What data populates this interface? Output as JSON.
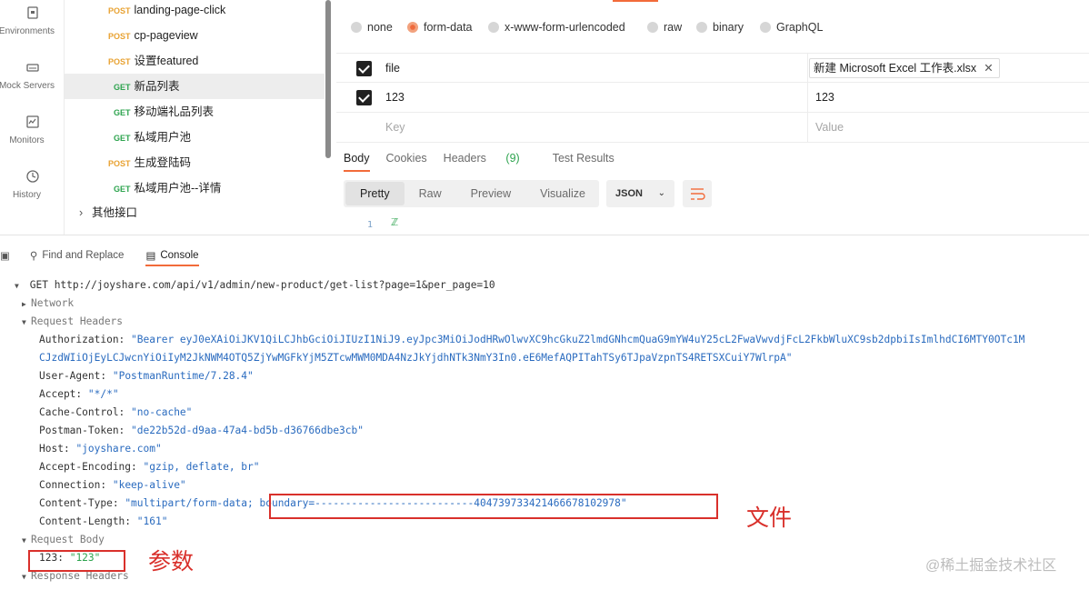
{
  "rail": {
    "items": [
      {
        "label": "Environments",
        "icon": "environments-icon"
      },
      {
        "label": "Mock Servers",
        "icon": "mock-servers-icon"
      },
      {
        "label": "Monitors",
        "icon": "monitors-icon"
      },
      {
        "label": "History",
        "icon": "history-icon"
      }
    ]
  },
  "tree": {
    "items": [
      {
        "method": "POST",
        "name": "landing-page-click"
      },
      {
        "method": "POST",
        "name": "cp-pageview"
      },
      {
        "method": "POST",
        "name": "设置featured"
      },
      {
        "method": "GET",
        "name": "新品列表"
      },
      {
        "method": "GET",
        "name": "移动端礼品列表"
      },
      {
        "method": "GET",
        "name": "私域用户池"
      },
      {
        "method": "POST",
        "name": "生成登陆码"
      },
      {
        "method": "GET",
        "name": "私域用户池--详情"
      }
    ],
    "folder": "其他接口"
  },
  "body_types": [
    "none",
    "form-data",
    "x-www-form-urlencoded",
    "raw",
    "binary",
    "GraphQL"
  ],
  "form_rows": [
    {
      "key": "file",
      "value": "新建 Microsoft Excel 工作表.xlsx"
    },
    {
      "key": "123",
      "value": "123"
    }
  ],
  "form_placeholder": {
    "key": "Key",
    "value": "Value"
  },
  "response": {
    "tabs": {
      "body": "Body",
      "cookies": "Cookies",
      "headers": "Headers",
      "headers_count": "(9)",
      "tests": "Test Results"
    },
    "views": [
      "Pretty",
      "Raw",
      "Preview",
      "Visualize"
    ],
    "format": "JSON",
    "line_number": "1"
  },
  "console": {
    "tabs": {
      "find": "Find and Replace",
      "console": "Console"
    },
    "request_line": "GET http://joyshare.com/api/v1/admin/new-product/get-list?page=1&per_page=10",
    "network": "Network",
    "request_headers_title": "Request Headers",
    "headers": [
      {
        "k": "Authorization:",
        "v": "\"Bearer eyJ0eXAiOiJKV1QiLCJhbGciOiJIUzI1NiJ9.eyJpc3MiOiJodHRwOlwvXC9hcGkuZ2lmdGNhcmQuaG9mYW4uY25cL2FwaVwvdjFcL2FkbWluXC9sb2dpbiIsImlhdCI6MTY0OTc1M"
      },
      {
        "k": "",
        "v": "CJzdWIiOjEyLCJwcnYiOiIyM2JkNWM4OTQ5ZjYwMGFkYjM5ZTcwMWM0MDA4NzJkYjdhNTk3NmY3In0.eE6MefAQPITahTSy6TJpaVzpnTS4RETSXCuiY7WlrpA\""
      },
      {
        "k": "User-Agent:",
        "v": "\"PostmanRuntime/7.28.4\""
      },
      {
        "k": "Accept:",
        "v": "\"*/*\""
      },
      {
        "k": "Cache-Control:",
        "v": "\"no-cache\""
      },
      {
        "k": "Postman-Token:",
        "v": "\"de22b52d-d9aa-47a4-bd5b-d36766dbe3cb\""
      },
      {
        "k": "Host:",
        "v": "\"joyshare.com\""
      },
      {
        "k": "Accept-Encoding:",
        "v": "\"gzip, deflate, br\""
      },
      {
        "k": "Connection:",
        "v": "\"keep-alive\""
      },
      {
        "k": "Content-Type:",
        "v": "\"multipart/form-data; boundary=--------------------------404739733421466678102978\""
      },
      {
        "k": "Content-Length:",
        "v": "\"161\""
      }
    ],
    "request_body_title": "Request Body",
    "body_key": "123:",
    "body_value": "\"123\"",
    "response_headers_title": "Response Headers"
  },
  "annotations": {
    "file": "文件",
    "param": "参数"
  },
  "watermark": "@稀土掘金技术社区",
  "colors": {
    "accent": "#f26b3a",
    "post": "#e8a232",
    "get": "#2ea44f",
    "annotation": "#d9302b"
  }
}
